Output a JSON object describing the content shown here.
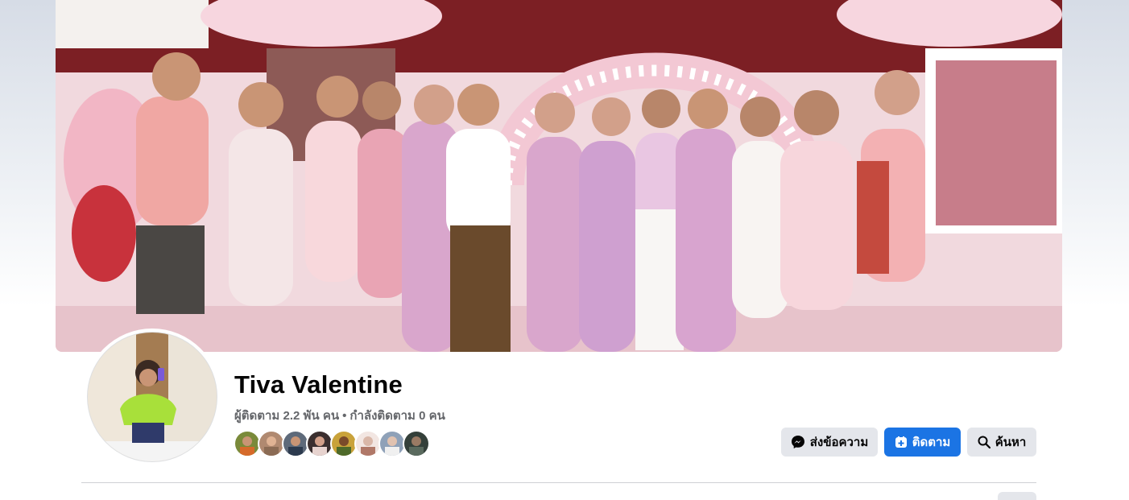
{
  "profile": {
    "name": "Tiva Valentine",
    "followers_text": "ผู้ติดตาม 2.2 พัน คน",
    "separator": "•",
    "following_text": "กำลังติดตาม 0 คน"
  },
  "actions": {
    "message_label": "ส่งข้อความ",
    "follow_label": "ติดตาม",
    "search_label": "ค้นหา"
  },
  "colors": {
    "primary_blue": "#1b74e4",
    "button_gray": "#e4e6eb",
    "text_primary": "#050505",
    "text_secondary": "#65676b"
  },
  "friends": [
    {
      "icon": "friend-avatar-1",
      "color": "#7a8a3a"
    },
    {
      "icon": "friend-avatar-2",
      "color": "#b08970"
    },
    {
      "icon": "friend-avatar-3",
      "color": "#5e6a7a"
    },
    {
      "icon": "friend-avatar-4",
      "color": "#3b2f2f"
    },
    {
      "icon": "friend-avatar-5",
      "color": "#c9a23a"
    },
    {
      "icon": "friend-avatar-6",
      "color": "#d9b7a8"
    },
    {
      "icon": "friend-avatar-7",
      "color": "#8fa1b8"
    },
    {
      "icon": "friend-avatar-8",
      "color": "#34403a"
    }
  ]
}
